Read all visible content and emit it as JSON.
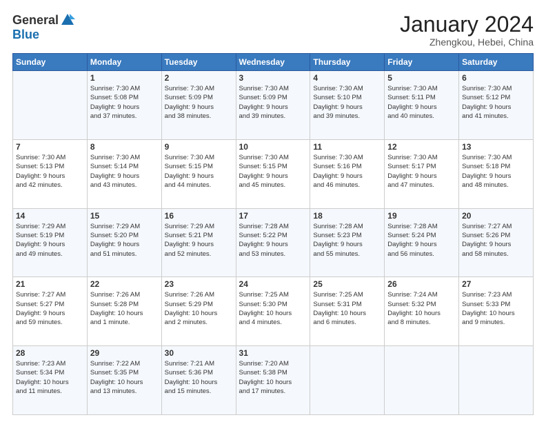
{
  "header": {
    "logo_general": "General",
    "logo_blue": "Blue",
    "month_title": "January 2024",
    "location": "Zhengkou, Hebei, China"
  },
  "weekdays": [
    "Sunday",
    "Monday",
    "Tuesday",
    "Wednesday",
    "Thursday",
    "Friday",
    "Saturday"
  ],
  "weeks": [
    [
      {
        "day": "",
        "info": ""
      },
      {
        "day": "1",
        "info": "Sunrise: 7:30 AM\nSunset: 5:08 PM\nDaylight: 9 hours\nand 37 minutes."
      },
      {
        "day": "2",
        "info": "Sunrise: 7:30 AM\nSunset: 5:09 PM\nDaylight: 9 hours\nand 38 minutes."
      },
      {
        "day": "3",
        "info": "Sunrise: 7:30 AM\nSunset: 5:09 PM\nDaylight: 9 hours\nand 39 minutes."
      },
      {
        "day": "4",
        "info": "Sunrise: 7:30 AM\nSunset: 5:10 PM\nDaylight: 9 hours\nand 39 minutes."
      },
      {
        "day": "5",
        "info": "Sunrise: 7:30 AM\nSunset: 5:11 PM\nDaylight: 9 hours\nand 40 minutes."
      },
      {
        "day": "6",
        "info": "Sunrise: 7:30 AM\nSunset: 5:12 PM\nDaylight: 9 hours\nand 41 minutes."
      }
    ],
    [
      {
        "day": "7",
        "info": "Sunrise: 7:30 AM\nSunset: 5:13 PM\nDaylight: 9 hours\nand 42 minutes."
      },
      {
        "day": "8",
        "info": "Sunrise: 7:30 AM\nSunset: 5:14 PM\nDaylight: 9 hours\nand 43 minutes."
      },
      {
        "day": "9",
        "info": "Sunrise: 7:30 AM\nSunset: 5:15 PM\nDaylight: 9 hours\nand 44 minutes."
      },
      {
        "day": "10",
        "info": "Sunrise: 7:30 AM\nSunset: 5:15 PM\nDaylight: 9 hours\nand 45 minutes."
      },
      {
        "day": "11",
        "info": "Sunrise: 7:30 AM\nSunset: 5:16 PM\nDaylight: 9 hours\nand 46 minutes."
      },
      {
        "day": "12",
        "info": "Sunrise: 7:30 AM\nSunset: 5:17 PM\nDaylight: 9 hours\nand 47 minutes."
      },
      {
        "day": "13",
        "info": "Sunrise: 7:30 AM\nSunset: 5:18 PM\nDaylight: 9 hours\nand 48 minutes."
      }
    ],
    [
      {
        "day": "14",
        "info": "Sunrise: 7:29 AM\nSunset: 5:19 PM\nDaylight: 9 hours\nand 49 minutes."
      },
      {
        "day": "15",
        "info": "Sunrise: 7:29 AM\nSunset: 5:20 PM\nDaylight: 9 hours\nand 51 minutes."
      },
      {
        "day": "16",
        "info": "Sunrise: 7:29 AM\nSunset: 5:21 PM\nDaylight: 9 hours\nand 52 minutes."
      },
      {
        "day": "17",
        "info": "Sunrise: 7:28 AM\nSunset: 5:22 PM\nDaylight: 9 hours\nand 53 minutes."
      },
      {
        "day": "18",
        "info": "Sunrise: 7:28 AM\nSunset: 5:23 PM\nDaylight: 9 hours\nand 55 minutes."
      },
      {
        "day": "19",
        "info": "Sunrise: 7:28 AM\nSunset: 5:24 PM\nDaylight: 9 hours\nand 56 minutes."
      },
      {
        "day": "20",
        "info": "Sunrise: 7:27 AM\nSunset: 5:26 PM\nDaylight: 9 hours\nand 58 minutes."
      }
    ],
    [
      {
        "day": "21",
        "info": "Sunrise: 7:27 AM\nSunset: 5:27 PM\nDaylight: 9 hours\nand 59 minutes."
      },
      {
        "day": "22",
        "info": "Sunrise: 7:26 AM\nSunset: 5:28 PM\nDaylight: 10 hours\nand 1 minute."
      },
      {
        "day": "23",
        "info": "Sunrise: 7:26 AM\nSunset: 5:29 PM\nDaylight: 10 hours\nand 2 minutes."
      },
      {
        "day": "24",
        "info": "Sunrise: 7:25 AM\nSunset: 5:30 PM\nDaylight: 10 hours\nand 4 minutes."
      },
      {
        "day": "25",
        "info": "Sunrise: 7:25 AM\nSunset: 5:31 PM\nDaylight: 10 hours\nand 6 minutes."
      },
      {
        "day": "26",
        "info": "Sunrise: 7:24 AM\nSunset: 5:32 PM\nDaylight: 10 hours\nand 8 minutes."
      },
      {
        "day": "27",
        "info": "Sunrise: 7:23 AM\nSunset: 5:33 PM\nDaylight: 10 hours\nand 9 minutes."
      }
    ],
    [
      {
        "day": "28",
        "info": "Sunrise: 7:23 AM\nSunset: 5:34 PM\nDaylight: 10 hours\nand 11 minutes."
      },
      {
        "day": "29",
        "info": "Sunrise: 7:22 AM\nSunset: 5:35 PM\nDaylight: 10 hours\nand 13 minutes."
      },
      {
        "day": "30",
        "info": "Sunrise: 7:21 AM\nSunset: 5:36 PM\nDaylight: 10 hours\nand 15 minutes."
      },
      {
        "day": "31",
        "info": "Sunrise: 7:20 AM\nSunset: 5:38 PM\nDaylight: 10 hours\nand 17 minutes."
      },
      {
        "day": "",
        "info": ""
      },
      {
        "day": "",
        "info": ""
      },
      {
        "day": "",
        "info": ""
      }
    ]
  ]
}
